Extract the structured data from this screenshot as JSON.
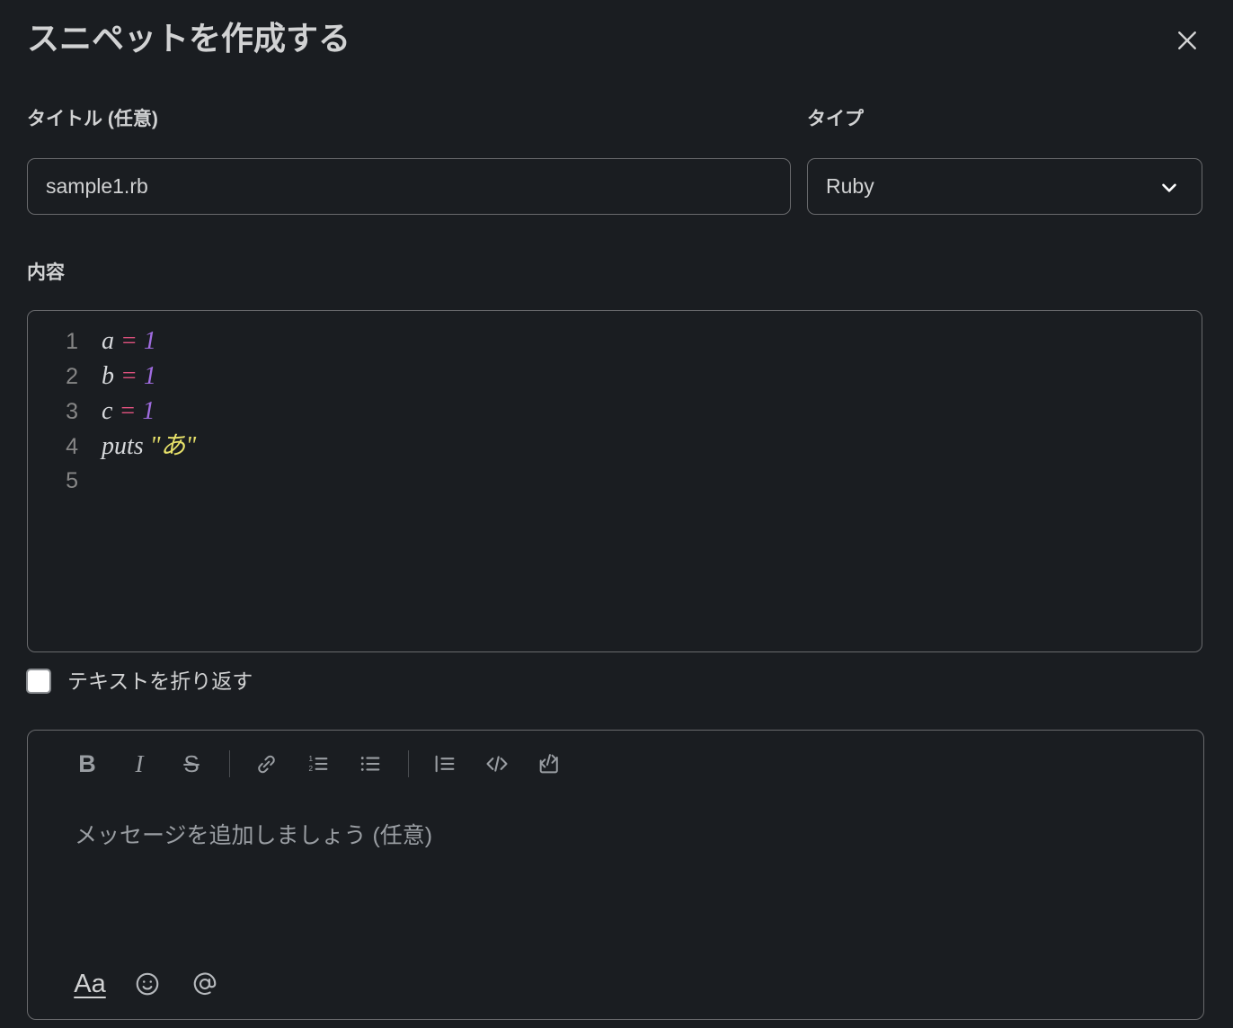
{
  "dialog": {
    "title": "スニペットを作成する",
    "close_icon": "close-icon"
  },
  "fields": {
    "title_label": "タイトル (任意)",
    "title_value": "sample1.rb",
    "type_label": "タイプ",
    "type_value": "Ruby",
    "content_label": "内容"
  },
  "editor": {
    "lines": [
      {
        "number": "1",
        "tokens": [
          {
            "text": "a",
            "kind": "var"
          },
          {
            "text": " ",
            "kind": "plain"
          },
          {
            "text": "=",
            "kind": "op"
          },
          {
            "text": " ",
            "kind": "plain"
          },
          {
            "text": "1",
            "kind": "num"
          }
        ]
      },
      {
        "number": "2",
        "tokens": [
          {
            "text": "b",
            "kind": "var"
          },
          {
            "text": " ",
            "kind": "plain"
          },
          {
            "text": "=",
            "kind": "op"
          },
          {
            "text": " ",
            "kind": "plain"
          },
          {
            "text": "1",
            "kind": "num"
          }
        ]
      },
      {
        "number": "3",
        "tokens": [
          {
            "text": "c",
            "kind": "var"
          },
          {
            "text": " ",
            "kind": "plain"
          },
          {
            "text": "=",
            "kind": "op"
          },
          {
            "text": " ",
            "kind": "plain"
          },
          {
            "text": "1",
            "kind": "num"
          }
        ]
      },
      {
        "number": "4",
        "tokens": [
          {
            "text": "puts",
            "kind": "kw"
          },
          {
            "text": " ",
            "kind": "plain"
          },
          {
            "text": "\"あ\"",
            "kind": "str"
          }
        ]
      },
      {
        "number": "5",
        "tokens": []
      }
    ],
    "colors": {
      "variable": "#d7d9dc",
      "operator": "#e0527f",
      "number": "#a06ce0",
      "string": "#e8e26a",
      "line_number": "#868686",
      "background": "#1a1d21"
    }
  },
  "wrap": {
    "label": "テキストを折り返す",
    "checked": false
  },
  "composer": {
    "placeholder": "メッセージを追加しましょう (任意)",
    "toolbar": [
      {
        "name": "bold-icon",
        "label": "B"
      },
      {
        "name": "italic-icon",
        "label": "I"
      },
      {
        "name": "strikethrough-icon",
        "label": "S"
      },
      {
        "name": "link-icon",
        "label": ""
      },
      {
        "name": "ordered-list-icon",
        "label": ""
      },
      {
        "name": "bulleted-list-icon",
        "label": ""
      },
      {
        "name": "blockquote-icon",
        "label": ""
      },
      {
        "name": "code-icon",
        "label": ""
      },
      {
        "name": "code-block-icon",
        "label": ""
      }
    ],
    "bottom_actions": [
      {
        "name": "formatting-icon",
        "label": "Aa"
      },
      {
        "name": "emoji-icon",
        "label": ""
      },
      {
        "name": "mention-icon",
        "label": "@"
      }
    ]
  }
}
